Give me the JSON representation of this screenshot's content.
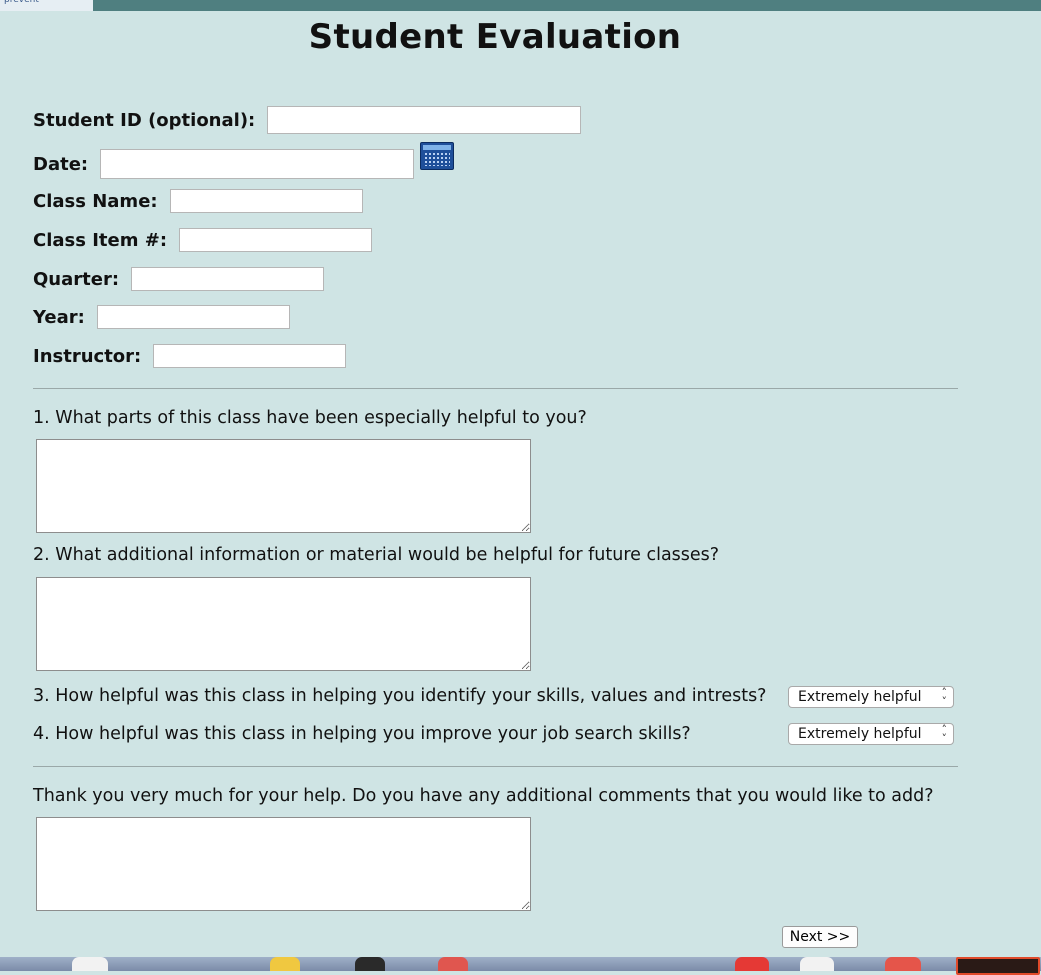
{
  "browser": {
    "tab_label": "prevent"
  },
  "page": {
    "title": "Student Evaluation"
  },
  "fields": {
    "student_id": {
      "label": "Student ID (optional):",
      "value": ""
    },
    "date": {
      "label": "Date:",
      "value": ""
    },
    "class_name": {
      "label": "Class Name:",
      "value": ""
    },
    "class_item": {
      "label": "Class Item #:",
      "value": ""
    },
    "quarter": {
      "label": "Quarter:",
      "value": ""
    },
    "year": {
      "label": "Year:",
      "value": ""
    },
    "instructor": {
      "label": "Instructor:",
      "value": ""
    }
  },
  "questions": {
    "q1": {
      "text": "1. What parts of this class have been especially helpful to you?",
      "value": ""
    },
    "q2": {
      "text": "2. What additional information or material would be helpful for future classes?",
      "value": ""
    },
    "q3": {
      "text": "3. How helpful was this class in helping you identify your skills, values and intrests?",
      "selected": "Extremely helpful"
    },
    "q4": {
      "text": "4. How helpful was this class in helping you improve your job search skills?",
      "selected": "Extremely helpful"
    },
    "comments": {
      "text": "Thank you very much for your help. Do you have any additional comments that you would like to add?",
      "value": ""
    }
  },
  "actions": {
    "next_label": "Next >>"
  },
  "icons": {
    "calendar": "calendar-icon",
    "select_chevron": "chevron-up-down-icon"
  },
  "colors": {
    "background": "#cfe4e4",
    "topbar": "#4f7f80",
    "calendar_icon": "#1f4f9a"
  }
}
